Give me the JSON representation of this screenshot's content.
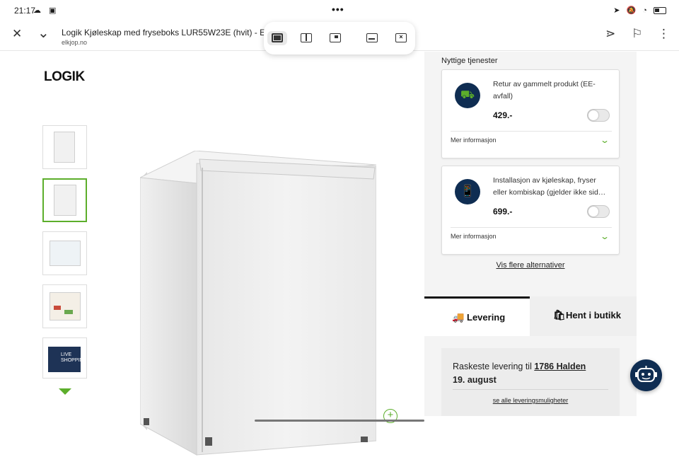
{
  "status_bar": {
    "time": "21:17",
    "left_icons": "☁ ▣",
    "dots": "•••",
    "right_icons": "➤ 🔕 ◔"
  },
  "browser": {
    "title": "Logik Kjøleskap med fryseboks LUR55W23E (hvit) - Elkjø",
    "domain": "elkjop.no",
    "close_glyph": "✕",
    "collapse_glyph": "⌄",
    "share_glyph": "⋖",
    "bookmark_glyph": "⚐",
    "menu_glyph": "⋮"
  },
  "product": {
    "brand_logo": "LOGIK",
    "thumbnail_count": 5,
    "selected_thumbnail": 2,
    "video_thumb_text": "LIVE SHOPPING",
    "zoom_glyph": "+"
  },
  "services": {
    "heading": "Nyttige tjenester",
    "items": [
      {
        "name": "Retur av gammelt produkt (EE-avfall)",
        "price": "429.-",
        "more": "Mer informasjon",
        "icon": "truck-icon",
        "icon_glyph": "⛟",
        "enabled": false
      },
      {
        "name": "Installasjon av kjøleskap, fryser eller kombiskap (gjelder ikke sid…",
        "price": "699.-",
        "more": "Mer informasjon",
        "icon": "phone-check-icon",
        "icon_glyph": "📱",
        "enabled": false
      }
    ],
    "chevron_glyph": "⌄",
    "more_alternatives": "Vis flere alternativer"
  },
  "delivery_tabs": {
    "delivery_label": "Levering",
    "delivery_glyph": "🚚",
    "pickup_label": "Hent i butikk",
    "pickup_glyph": "🛍"
  },
  "delivery_info": {
    "prefix": "Raskeste levering til ",
    "city": "1786 Halden",
    "date": "19. august",
    "link": "se alle leveringsmuligheter"
  },
  "colors": {
    "accent_green": "#5cae2b",
    "navy": "#0f2d52"
  }
}
